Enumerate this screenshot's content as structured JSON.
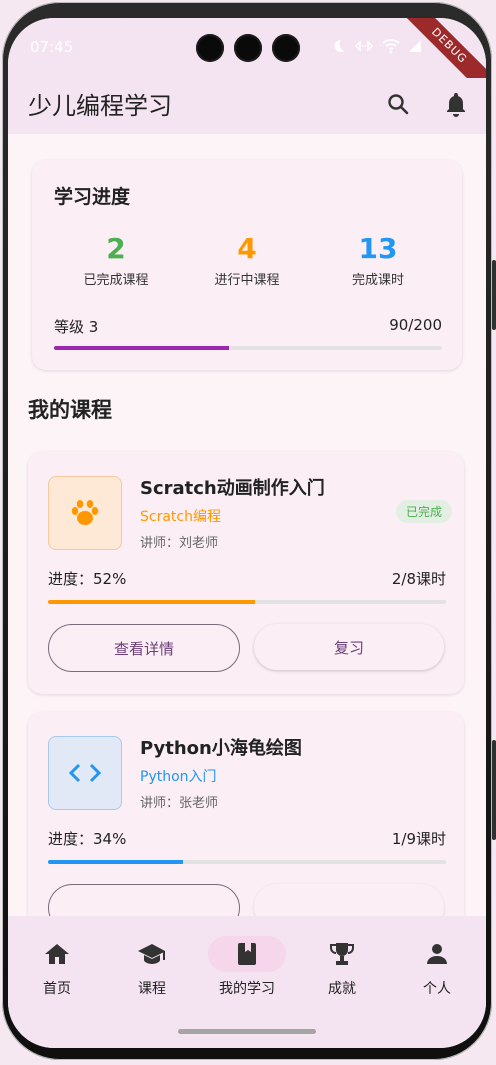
{
  "status_bar": {
    "time": "07:45",
    "debug_label": "DEBUG"
  },
  "app_bar": {
    "title": "少儿编程学习",
    "search_icon": "search-icon",
    "bell_icon": "bell-icon"
  },
  "progress_card": {
    "title": "学习进度",
    "stats": [
      {
        "value": "2",
        "label": "已完成课程",
        "color": "#4caf50"
      },
      {
        "value": "4",
        "label": "进行中课程",
        "color": "#ff9800"
      },
      {
        "value": "13",
        "label": "完成课时",
        "color": "#2196f3"
      }
    ],
    "level_label": "等级 3",
    "points": "90/200",
    "level_progress": 0.45,
    "bar_color": "#9c27b0"
  },
  "section_title": "我的课程",
  "courses": [
    {
      "title": "Scratch动画制作入门",
      "category": "Scratch编程",
      "category_color": "#ff9800",
      "teacher": "讲师：刘老师",
      "badge": "已完成",
      "progress_label": "进度：52%",
      "progress": 0.52,
      "lessons": "2/8课时",
      "icon": "paw-icon",
      "details_button": "查看详情",
      "action_button": "复习"
    },
    {
      "title": "Python小海龟绘图",
      "category": "Python入门",
      "category_color": "#2196f3",
      "teacher": "讲师：张老师",
      "progress_label": "进度：34%",
      "progress": 0.34,
      "lessons": "1/9课时",
      "icon": "code-icon"
    }
  ],
  "bottom_nav": [
    {
      "label": "首页",
      "icon": "home-icon"
    },
    {
      "label": "课程",
      "icon": "school-icon"
    },
    {
      "label": "我的学习",
      "icon": "book-icon",
      "active": true
    },
    {
      "label": "成就",
      "icon": "trophy-icon"
    },
    {
      "label": "个人",
      "icon": "person-icon"
    }
  ]
}
